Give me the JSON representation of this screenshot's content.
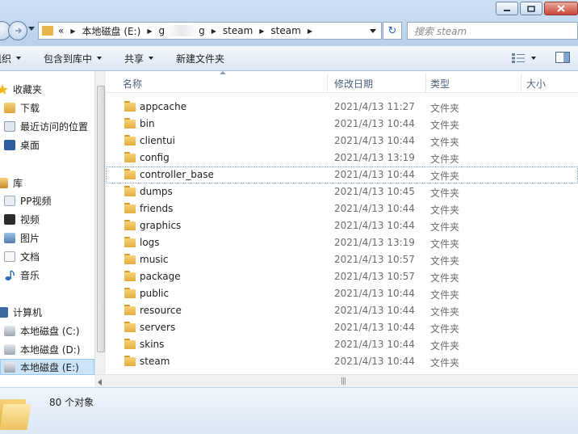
{
  "address": {
    "prefix": "«",
    "drive": "本地磁盘 (E:)",
    "blurred_segment_start": "g",
    "blurred_segment_end": "g",
    "segments": [
      "steam",
      "steam"
    ],
    "search_placeholder": "搜索 steam"
  },
  "toolbar": {
    "organize": "组织",
    "include_in_library": "包含到库中",
    "share": "共享",
    "new_folder": "新建文件夹"
  },
  "sidebar": {
    "favorites": "收藏夹",
    "downloads": "下载",
    "recent": "最近访问的位置",
    "desktop": "桌面",
    "libraries": "库",
    "pp_video": "PP视频",
    "videos": "视频",
    "pictures": "图片",
    "documents": "文档",
    "music": "音乐",
    "computer": "计算机",
    "drive_c": "本地磁盘 (C:)",
    "drive_d": "本地磁盘 (D:)",
    "drive_e": "本地磁盘 (E:)"
  },
  "columns": {
    "name": "名称",
    "modified": "修改日期",
    "type": "类型",
    "size": "大小"
  },
  "files": [
    {
      "name": "appcache",
      "date": "2021/4/13 11:27",
      "type": "文件夹"
    },
    {
      "name": "bin",
      "date": "2021/4/13 10:44",
      "type": "文件夹"
    },
    {
      "name": "clientui",
      "date": "2021/4/13 10:44",
      "type": "文件夹"
    },
    {
      "name": "config",
      "date": "2021/4/13 13:19",
      "type": "文件夹"
    },
    {
      "name": "controller_base",
      "date": "2021/4/13 10:44",
      "type": "文件夹"
    },
    {
      "name": "dumps",
      "date": "2021/4/13 10:45",
      "type": "文件夹"
    },
    {
      "name": "friends",
      "date": "2021/4/13 10:44",
      "type": "文件夹"
    },
    {
      "name": "graphics",
      "date": "2021/4/13 10:44",
      "type": "文件夹"
    },
    {
      "name": "logs",
      "date": "2021/4/13 13:19",
      "type": "文件夹"
    },
    {
      "name": "music",
      "date": "2021/4/13 10:57",
      "type": "文件夹"
    },
    {
      "name": "package",
      "date": "2021/4/13 10:57",
      "type": "文件夹"
    },
    {
      "name": "public",
      "date": "2021/4/13 10:44",
      "type": "文件夹"
    },
    {
      "name": "resource",
      "date": "2021/4/13 10:44",
      "type": "文件夹"
    },
    {
      "name": "servers",
      "date": "2021/4/13 10:44",
      "type": "文件夹"
    },
    {
      "name": "skins",
      "date": "2021/4/13 10:44",
      "type": "文件夹"
    },
    {
      "name": "steam",
      "date": "2021/4/13 10:44",
      "type": "文件夹"
    }
  ],
  "status": {
    "count": "80 个对象"
  },
  "colors": {
    "folder": "#e4ad3d",
    "chrome": "#cfe0f2",
    "selection": "#cce4f7"
  }
}
